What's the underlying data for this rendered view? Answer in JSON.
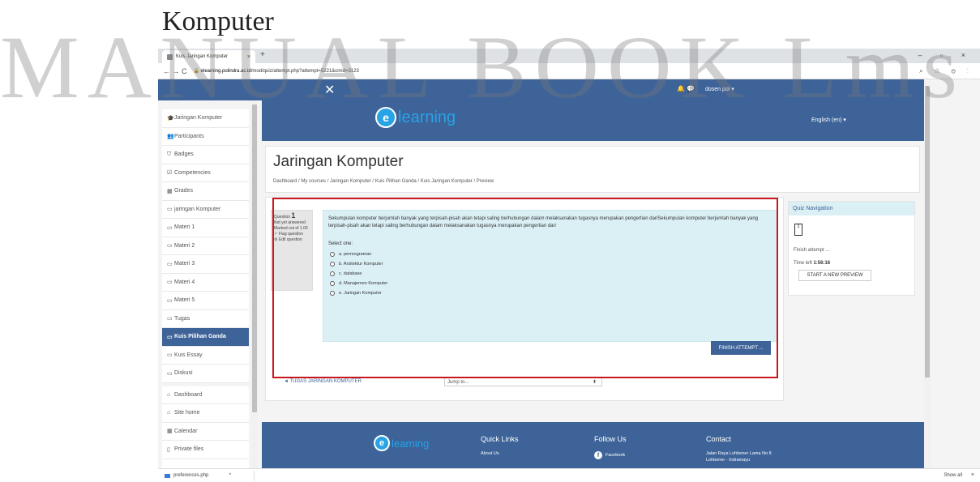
{
  "watermark": {
    "top_text": "Komputer",
    "big_text": "MANUAL BOOK Lms"
  },
  "browser": {
    "tab_title": "Kuis Jaringan Komputer",
    "tab_close": "×",
    "new_tab": "+",
    "window_controls": "– ▫ ×",
    "nav": "← → C",
    "url_host": "elearning.polindra.ac.id",
    "url_path": "/mod/quiz/attempt.php?attempt=5221&cmid=3123",
    "addr_right": "⌕ ☆ ⊖ ⋮"
  },
  "topnav": {
    "close": "✕",
    "icons": "🔔 💬",
    "user": "dosen pol ▾"
  },
  "sidebar": {
    "items": [
      {
        "icon": "🎓",
        "label": "Jaringan Komputer"
      },
      {
        "icon": "👥",
        "label": "Participants"
      },
      {
        "icon": "⛉",
        "label": "Badges"
      },
      {
        "icon": "☑",
        "label": "Competencies"
      },
      {
        "icon": "▦",
        "label": "Grades"
      },
      {
        "icon": "▭",
        "label": "jaringan Komputer"
      },
      {
        "icon": "▭",
        "label": "Materi 1"
      },
      {
        "icon": "▭",
        "label": "Materi 2"
      },
      {
        "icon": "▭",
        "label": "Materi 3"
      },
      {
        "icon": "▭",
        "label": "Materi 4"
      },
      {
        "icon": "▭",
        "label": "Materi 5"
      },
      {
        "icon": "▭",
        "label": "Tugas"
      },
      {
        "icon": "▭",
        "label": "Kuis Pilihan Ganda"
      },
      {
        "icon": "▭",
        "label": "Kuis Essay"
      },
      {
        "icon": "▭",
        "label": "Diskusi"
      },
      {
        "icon": "⌂",
        "label": "Dashboard"
      },
      {
        "icon": "⌂",
        "label": "Site home"
      },
      {
        "icon": "▦",
        "label": "Calendar"
      },
      {
        "icon": "▯",
        "label": "Private files"
      }
    ]
  },
  "header": {
    "logo_letter": "e",
    "logo_word": "learning",
    "language": "English (en) ▾"
  },
  "page": {
    "title": "Jaringan Komputer",
    "breadcrumb": "Dashboard / My courses / Jaringan Komputer / Kuis Pilihan Ganda / Kuis Jaringan Komputer / Preview"
  },
  "question": {
    "label": "Question",
    "number": "1",
    "status": "Not yet answered",
    "marked": "Marked out of 1.00",
    "flag": "⚐ Flag question",
    "edit": "⚙ Edit question",
    "text": "Sekumpulan komputer berjumlah banyak yang terpisah-pisah akan tetapi saling berhubungan dalam melaksanakan tugasnya merupakan pengertian dariSekumpulan komputer berjumlah banyak yang terpisah-pisah akan tetapi saling berhubungan dalam melaksanakan tugasnya merupakan pengertian dari",
    "select_one": "Select one:",
    "options": [
      "a. pemrograman",
      "b. Arsitektur Komputer",
      "c. database",
      "d. Manajemen Komputer",
      "e. Jaringan Komputer"
    ],
    "finish_button": "FINISH ATTEMPT ..."
  },
  "bottom_nav": {
    "prev_link": "◄ TUGAS JARINGAN KOMPUTER",
    "jump_label": "Jump to...",
    "jump_caret": "⬍"
  },
  "quiz_navigation": {
    "title": "Quiz Navigation",
    "box_number": "1",
    "finish_attempt": "Finish attempt ...",
    "time_left_label": "Time left",
    "time_left_value": "1:56:16",
    "start_new_preview": "START A NEW PREVIEW"
  },
  "footer": {
    "logo_letter": "e",
    "logo_word": "learning",
    "quick_links_title": "Quick Links",
    "quick_links_item": "About Us",
    "follow_us_title": "Follow Us",
    "facebook_icon": "f",
    "facebook": "Facebook",
    "contact_title": "Contact",
    "contact_address": "Jalan Raya Lohbener Lama No 8",
    "contact_city": "Lohbener - Indramayu"
  },
  "downloads": {
    "file": "preferences.php",
    "caret": "^",
    "show_all": "Show all",
    "close": "×"
  },
  "colors": {
    "primary": "#3d6399",
    "accent": "#28a3e5",
    "question_bg": "#dbf0f5",
    "highlight_border": "#c8171e"
  }
}
